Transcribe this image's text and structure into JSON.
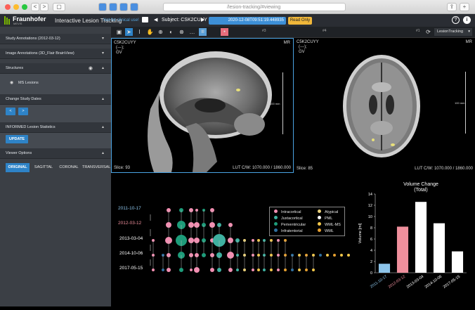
{
  "browser": {
    "url_text": "/lesion-tracking/#viewing",
    "nav_back": "<",
    "nav_fwd": ">",
    "sidebar_btn": "▢"
  },
  "app": {
    "logo": "Fraunhofer",
    "logo_sub": "MEVIS",
    "title": "Interactive Lesion Tracking",
    "clinical_note": "Not for clinical use!",
    "subject_label": "Subject: CSK2CUYY",
    "session_date": "2020-12-08T09:51:19.448935",
    "read_only": "Read Only",
    "help_icon": "?",
    "info_icon": "i"
  },
  "sidebar": {
    "sections": [
      {
        "label": "Study Annotations (2012-03-12)"
      },
      {
        "label": "Image Annotations (3D_Flair BrainView)"
      },
      {
        "label": "Structures"
      },
      {
        "label": "Change Study Dates"
      },
      {
        "label": "INFORMED Lesion Statistics"
      },
      {
        "label": "Viewer Options"
      }
    ],
    "ms_lesions": "MS Lesions",
    "prev": "<",
    "next": ">",
    "update": "UPDATE",
    "views": [
      "ORIGINAL",
      "SAGITTAL",
      "CORONAL",
      "TRANSVERSAL"
    ]
  },
  "toolbar": {
    "vp_labels": [
      "#1",
      "#2",
      "#3",
      "#4"
    ],
    "right_vp": "#1",
    "mode": "LesionTracking"
  },
  "viewport_left": {
    "patient": "C5K2CUYY",
    "line2": "(---);",
    "line3": "GV",
    "mr": "MR",
    "scale": "100 mm",
    "slice": "Slice: 93",
    "lut": "LUT C/W: 1070.000 / 1860.000"
  },
  "viewport_right": {
    "patient": "C5K2CUYY",
    "line2": "(---);",
    "line3": "GV",
    "mr": "MR",
    "scale": "100 mm",
    "slice": "Slice: 85",
    "lut": "LUT C/W: 1070.000 / 1860.000"
  },
  "timeline": {
    "dates": [
      {
        "label": "2011-10-17",
        "color": "#8cc4ea"
      },
      {
        "label": "2012-03-12",
        "color": "#ef8f9c"
      },
      {
        "label": "2013-03-04",
        "color": "#ffffff"
      },
      {
        "label": "2014-10-06",
        "color": "#ffffff"
      },
      {
        "label": "2017-05-15",
        "color": "#ffffff"
      }
    ]
  },
  "legend": [
    {
      "label": "Intracortical",
      "color": "#f28fb2"
    },
    {
      "label": "Juxtacortical",
      "color": "#3fb0a0"
    },
    {
      "label": "Periventricular",
      "color": "#1e9c7a"
    },
    {
      "label": "Infratentorial",
      "color": "#2f6f9f"
    },
    {
      "label": "Atypical",
      "color": "#e9d07a"
    },
    {
      "label": "PML",
      "color": "#ffffff"
    },
    {
      "label": "WML-MS",
      "color": "#f2c74a"
    },
    {
      "label": "WML",
      "color": "#e6a030"
    }
  ],
  "chart_data": {
    "type": "bar",
    "title": "Volume Change",
    "subtitle": "(Total)",
    "ylabel": "Volume [ml]",
    "categories": [
      "2011-10-17",
      "2012-03-12",
      "2013-03-04",
      "2014-10-06",
      "2017-05-15"
    ],
    "values": [
      1.6,
      8.2,
      12.6,
      8.8,
      3.8
    ],
    "colors": [
      "#8cc4ea",
      "#ef8f9c",
      "#ffffff",
      "#ffffff",
      "#ffffff"
    ],
    "ylim": [
      0,
      14
    ],
    "yticks": [
      0,
      2,
      4,
      6,
      8,
      10,
      12,
      14
    ]
  }
}
